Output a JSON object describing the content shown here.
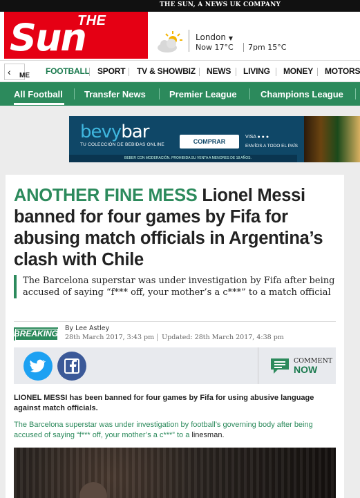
{
  "topbar": {
    "company": "THE SUN, A NEWS UK COMPANY"
  },
  "logo": {
    "the": "THE",
    "sun": "Sun"
  },
  "weather": {
    "city": "London",
    "now": "Now 17°C",
    "later": "7pm 15°C"
  },
  "nav": {
    "back_tail": "ME",
    "items": [
      "FOOTBALL",
      "SPORT",
      "TV & SHOWBIZ",
      "NEWS",
      "LIVING",
      "MONEY",
      "MOTORS"
    ]
  },
  "subnav": {
    "items": [
      "All Football",
      "Transfer News",
      "Premier League",
      "Champions League"
    ]
  },
  "ad": {
    "brand_a": "bevy",
    "brand_b": "bar",
    "tagline": "TU COLECCIÓN DE BEBIDAS ONLINE",
    "cta": "COMPRAR",
    "cards": "VISA ● ● ●",
    "envios": "ENVÍOS A TODO EL PAÍS",
    "footer": "BEBER CON MODERACIÓN. PROHIBIDA SU VENTA A MENORES DE 18 AÑOS."
  },
  "article": {
    "kicker": "ANOTHER FINE MESS",
    "headline": "Lionel Messi banned for four games by Fifa for abusing match officials in Argentina’s clash with Chile",
    "standfirst": "The Barcelona superstar was under investigation by Fifa after being accused of saying “f*** off, your mother’s a c***” to a match official",
    "badge": "BREAKING",
    "byline": "By Lee Astley",
    "published": "28th March 2017, 3:43 pm",
    "updated": "Updated: 28th March 2017, 4:38 pm",
    "comment_top": "COMMENT",
    "comment_now": "NOW",
    "lead": "LIONEL MESSI has been banned for four games by Fifa for using abusive language against match officials.",
    "para": "The Barcelona superstar was under investigation by football’s governing body after being accused of saying “f*** off, your mother’s a c***” to a",
    "para_tail": "linesman."
  },
  "colors": {
    "brand_red": "#e50014",
    "sun_green": "#2c8a5c",
    "twitter": "#1da1f2",
    "facebook": "#3b5998"
  }
}
